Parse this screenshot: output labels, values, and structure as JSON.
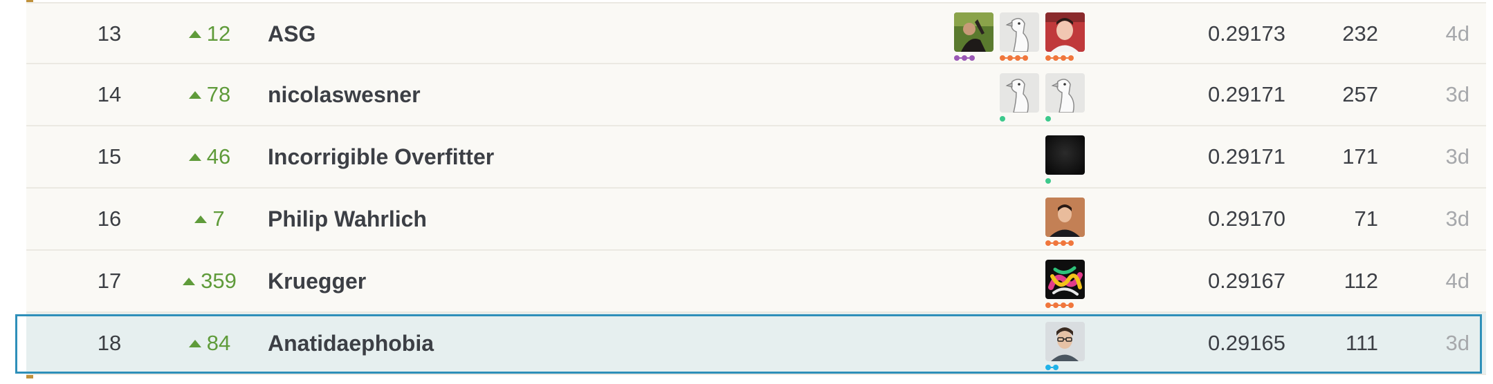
{
  "leaderboard": {
    "rows": [
      {
        "rank": "13",
        "change": "12",
        "team": "ASG",
        "score": "0.29173",
        "entries": "232",
        "last": "4d"
      },
      {
        "rank": "14",
        "change": "78",
        "team": "nicolaswesner",
        "score": "0.29171",
        "entries": "257",
        "last": "3d"
      },
      {
        "rank": "15",
        "change": "46",
        "team": "Incorrigible Overfitter",
        "score": "0.29171",
        "entries": "171",
        "last": "3d"
      },
      {
        "rank": "16",
        "change": "7",
        "team": "Philip Wahrlich",
        "score": "0.29170",
        "entries": "71",
        "last": "3d"
      },
      {
        "rank": "17",
        "change": "359",
        "team": "Kruegger",
        "score": "0.29167",
        "entries": "112",
        "last": "4d"
      },
      {
        "rank": "18",
        "change": "84",
        "team": "Anatidaephobia",
        "score": "0.29165",
        "entries": "111",
        "last": "3d"
      }
    ]
  },
  "colors": {
    "accent_bar": "#c0913a",
    "rank_up": "#5f9b3a",
    "highlight_row": "#e6efef",
    "highlight_border": "#2e8fb9",
    "tier_purple": "#9b59b6",
    "tier_orange": "#f0763c",
    "tier_green": "#3cc98c",
    "tier_blue": "#20b2e8"
  }
}
